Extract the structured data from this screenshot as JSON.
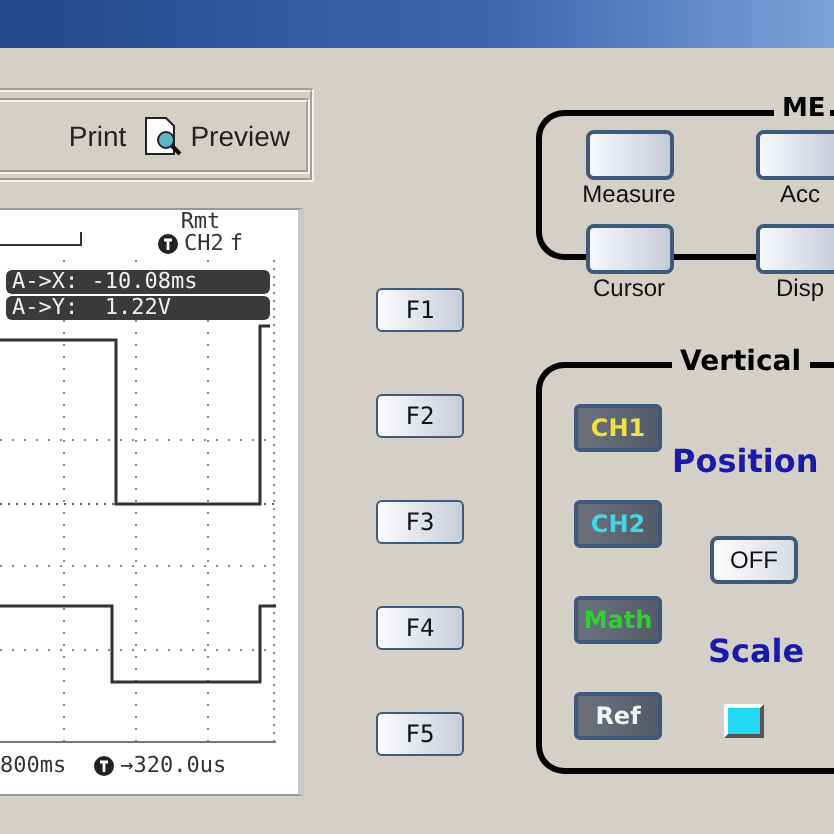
{
  "toolbar": {
    "buttons": [
      {
        "label": "Print",
        "kind": "text"
      },
      {
        "label": "Preview",
        "kind": "icon"
      }
    ]
  },
  "scope": {
    "status": "Rmt",
    "trigger_source": "CH2",
    "trigger_slope": "f",
    "readouts": [
      "A->X: -10.08ms",
      "A->Y:  1.22V"
    ],
    "timebase": "800ms",
    "trigger_offset": "→320.0us"
  },
  "function_keys": [
    "F1",
    "F2",
    "F3",
    "F4",
    "F5"
  ],
  "menu_group": {
    "title": "ME",
    "buttons": [
      {
        "label": "Measure"
      },
      {
        "label": "Acc"
      },
      {
        "label": "Cursor"
      },
      {
        "label": "Disp"
      }
    ]
  },
  "vertical": {
    "title": "Vertical",
    "channels": [
      {
        "label": "CH1",
        "color": "#f0e040"
      },
      {
        "label": "CH2",
        "color": "#40d8e8"
      },
      {
        "label": "Math",
        "color": "#30d030"
      },
      {
        "label": "Ref",
        "color": "#f4f4f4"
      }
    ],
    "position_label": "Position",
    "off_button": "OFF",
    "scale_label": "Scale",
    "indicator": {
      "on": true
    }
  }
}
